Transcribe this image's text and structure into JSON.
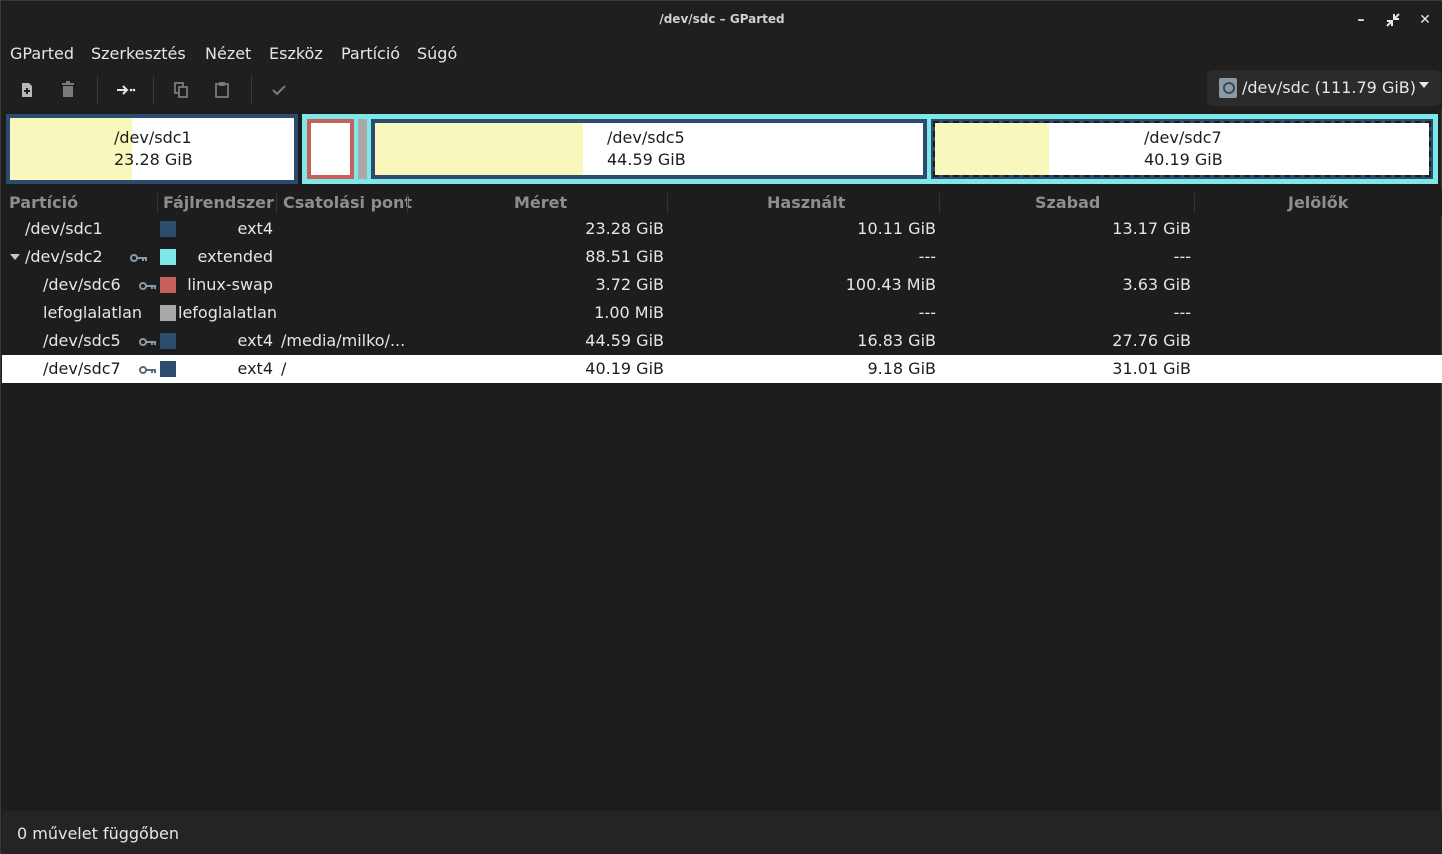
{
  "window": {
    "title": "/dev/sdc – GParted"
  },
  "menu": {
    "items": [
      "GParted",
      "Szerkesztés",
      "Nézet",
      "Eszköz",
      "Partíció",
      "Súgó"
    ]
  },
  "toolbar": {
    "buttons": [
      "new-partition-icon",
      "delete-icon",
      "resize-move-icon",
      "copy-icon",
      "paste-icon",
      "apply-icon"
    ],
    "device_label": "/dev/sdc (111.79 GiB)"
  },
  "map": {
    "sdc1": {
      "name": "/dev/sdc1",
      "size": "23.28 GiB",
      "used_fraction": 0.43
    },
    "sdc5": {
      "name": "/dev/sdc5",
      "size": "44.59 GiB",
      "used_fraction": 0.38
    },
    "sdc7": {
      "name": "/dev/sdc7",
      "size": "40.19 GiB",
      "used_fraction": 0.23
    }
  },
  "table": {
    "headers": [
      "Partíció",
      "Fájlrendszer",
      "Csatolási pont",
      "Méret",
      "Használt",
      "Szabad",
      "Jelölők"
    ],
    "rows": [
      {
        "partition": "/dev/sdc1",
        "filesystem": "ext4",
        "mount": "",
        "size": "23.28 GiB",
        "used": "10.11 GiB",
        "free": "13.17 GiB",
        "color": "#2c4b6e",
        "key": false
      },
      {
        "partition": "/dev/sdc2",
        "filesystem": "extended",
        "mount": "",
        "size": "88.51 GiB",
        "used": "---",
        "free": "---",
        "color": "#7ee8e8",
        "key": true
      },
      {
        "partition": "/dev/sdc6",
        "filesystem": "linux-swap",
        "mount": "",
        "size": "3.72 GiB",
        "used": "100.43 MiB",
        "free": "3.63 GiB",
        "color": "#c8605a",
        "key": true
      },
      {
        "partition": "lefoglalatlan",
        "filesystem": "lefoglalatlan",
        "mount": "",
        "size": "1.00 MiB",
        "used": "---",
        "free": "---",
        "color": "#a9a9a9",
        "key": false
      },
      {
        "partition": "/dev/sdc5",
        "filesystem": "ext4",
        "mount": "/media/milko/...",
        "size": "44.59 GiB",
        "used": "16.83 GiB",
        "free": "27.76 GiB",
        "color": "#2c4b6e",
        "key": true
      },
      {
        "partition": "/dev/sdc7",
        "filesystem": "ext4",
        "mount": "/",
        "size": "40.19 GiB",
        "used": "9.18 GiB",
        "free": "31.01 GiB",
        "color": "#2c4b6e",
        "key": true
      }
    ]
  },
  "status": {
    "text": "0 művelet függőben"
  }
}
